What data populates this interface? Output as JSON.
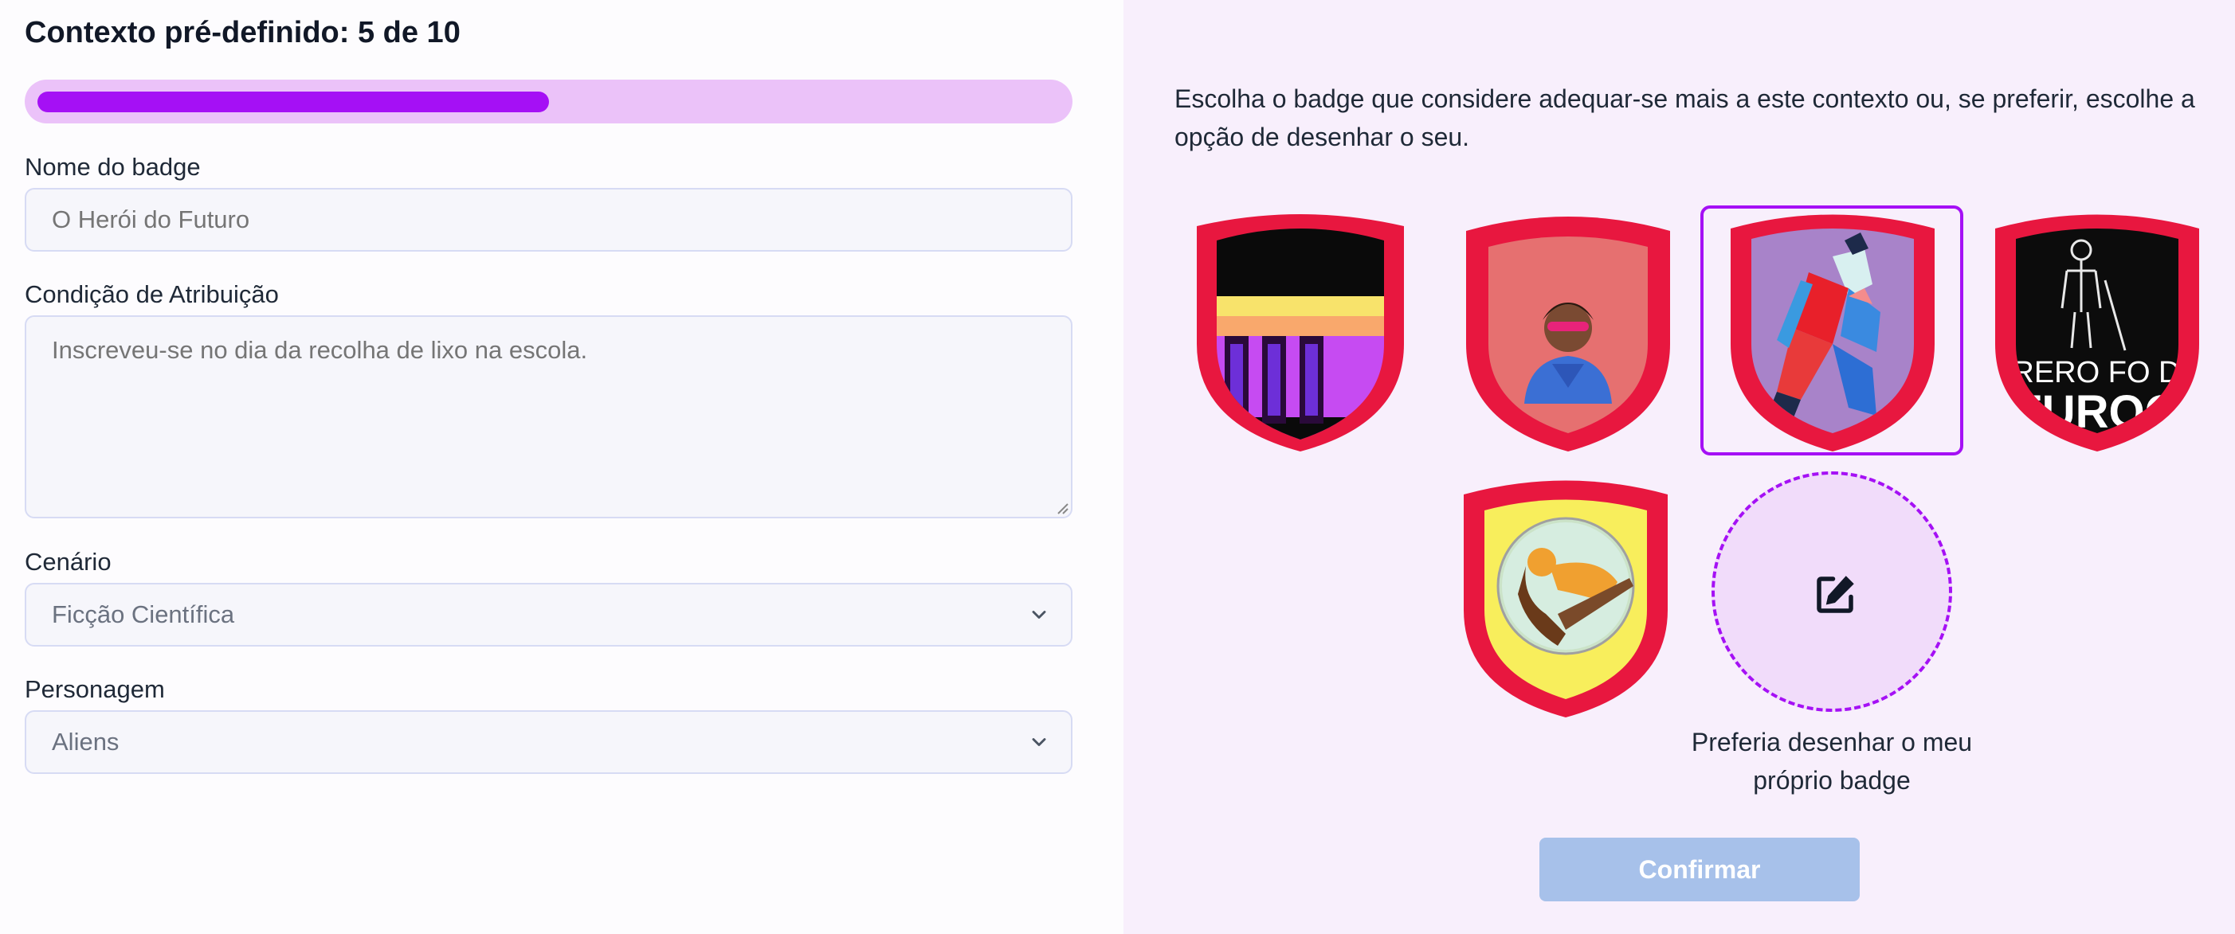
{
  "header": {
    "title": "Contexto pré-definido: 5 de 10",
    "progress": {
      "current": 5,
      "total": 10
    }
  },
  "form": {
    "badge_name": {
      "label": "Nome do badge",
      "placeholder": "O Herói do Futuro"
    },
    "condition": {
      "label": "Condição de Atribuição",
      "placeholder": "Inscreveu-se no dia da recolha de lixo na escola."
    },
    "scenario": {
      "label": "Cenário",
      "value": "Ficção Científica"
    },
    "character": {
      "label": "Personagem",
      "value": "Aliens"
    }
  },
  "chooser": {
    "instructions": "Escolha o badge que considere adequar-se mais a este contexto ou, se preferir, escolhe a opção de desenhar o seu.",
    "badges": [
      {
        "name": "badge-aliens-sunset",
        "selected": false
      },
      {
        "name": "badge-superhero",
        "selected": false
      },
      {
        "name": "badge-runner",
        "selected": true
      },
      {
        "name": "badge-hero-text",
        "selected": false,
        "image_text": "URERO FO DO FUROG"
      },
      {
        "name": "badge-crouching-figure",
        "selected": false
      }
    ],
    "draw_own_caption": "Preferia desenhar o meu próprio badge",
    "confirm_label": "Confirmar"
  },
  "colors": {
    "accent": "#a510f5",
    "progress_track": "#ebc2f9",
    "badge_red": "#e8173f",
    "confirm_disabled": "#a7c1ea"
  }
}
